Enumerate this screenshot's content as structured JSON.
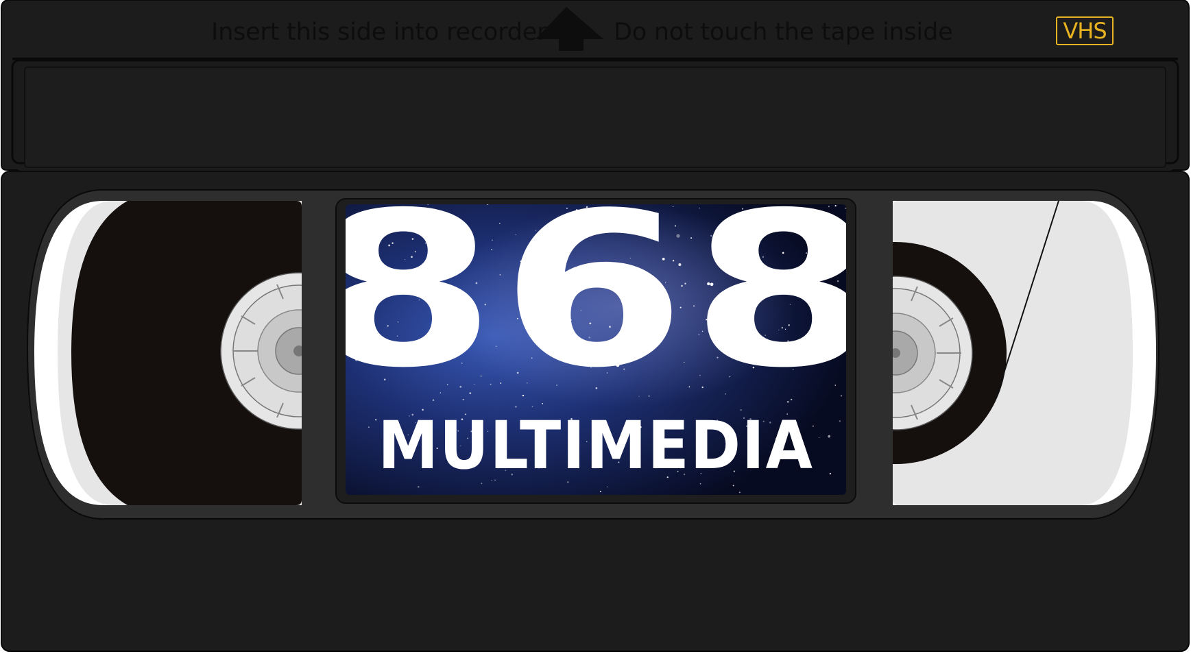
{
  "cassette": {
    "insert_text": "Insert this side into recorder",
    "warning_text": "Do not touch the tape inside",
    "format_badge": "VHS",
    "arrow_icon": "up-arrow-icon"
  },
  "label": {
    "number": "868",
    "word": "MULTIMEDIA",
    "background": "starfield-galaxy"
  },
  "colors": {
    "shell": "#1c1c1c",
    "window_rim": "#2e2e2e",
    "badge": "#e8b320",
    "label_text": "#ffffff",
    "tape": "#150f0e",
    "window_white": "#ffffff",
    "window_grey": "#e6e6e6"
  }
}
